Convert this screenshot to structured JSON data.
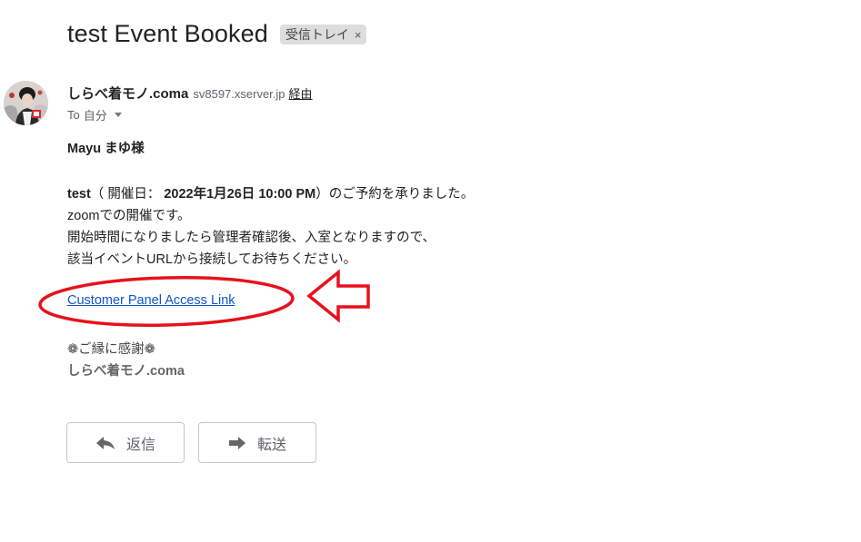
{
  "email": {
    "subject": "test Event Booked",
    "label_chip": "受信トレイ",
    "label_chip_close": "×",
    "sender_name": "しらべ着モノ.coma",
    "sender_email": "sv8597.xserver.jp",
    "via": "経由",
    "to_prefix": "To",
    "to_recipient": "自分"
  },
  "body": {
    "greeting": "Mayu まゆ様",
    "line1_event": "test",
    "line1_open": "（ 開催日： ",
    "line1_date": "2022年1月26日 10:00 PM",
    "line1_close": "）のご予約を承りました。",
    "line2": "zoomでの開催です。",
    "line3": "開始時間になりましたら管理者確認後、入室となりますので、",
    "line4": "該当イベントURLから接続してお待ちください。",
    "link_text": "Customer Panel Access Link",
    "signature_line1": "❁ご縁に感謝❁",
    "signature_line2": "しらべ着モノ.coma"
  },
  "actions": {
    "reply_label": "返信",
    "forward_label": "転送"
  },
  "colors": {
    "link": "#1155cc",
    "annotation_red": "#e8101c",
    "chip_bg": "#dddddd"
  },
  "icons": {
    "reply": "reply-arrow-icon",
    "forward": "forward-arrow-icon",
    "caret": "caret-down-icon",
    "chip_close": "close-icon"
  }
}
